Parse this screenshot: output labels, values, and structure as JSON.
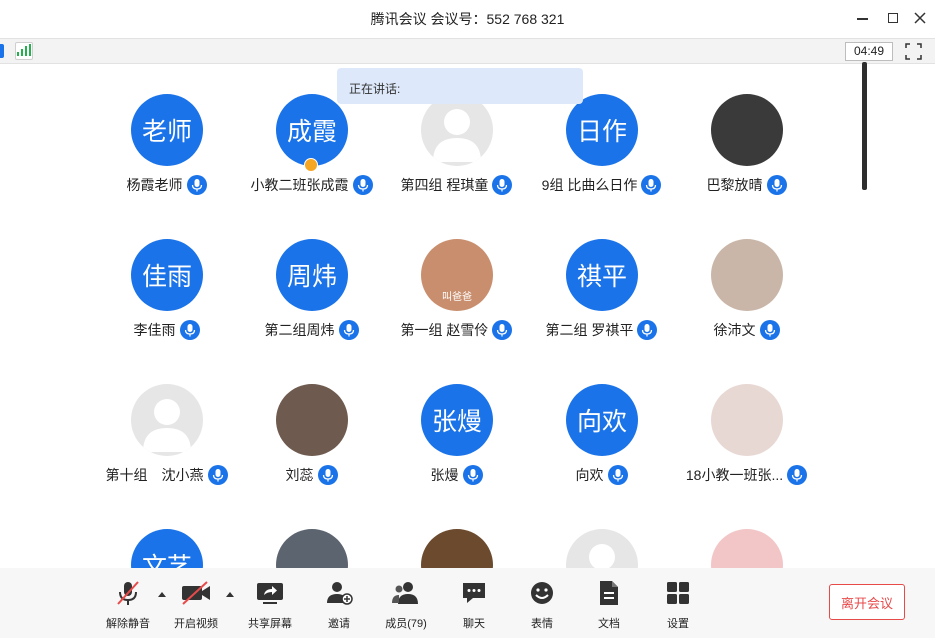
{
  "window": {
    "title": "腾讯会议 会议号：552 768 321"
  },
  "status": {
    "timer": "04:49"
  },
  "speaking": {
    "label": "正在讲话:"
  },
  "participants": [
    {
      "name": "杨霞老师",
      "avatar_text": "老师",
      "avatar_kind": "text"
    },
    {
      "name": "小教二班张成霞",
      "avatar_text": "成霞",
      "avatar_kind": "text",
      "host": true
    },
    {
      "name": "第四组 程琪童",
      "avatar_text": "",
      "avatar_kind": "default"
    },
    {
      "name": "9组 比曲么日作",
      "avatar_text": "日作",
      "avatar_kind": "text"
    },
    {
      "name": "巴黎放晴",
      "avatar_text": "",
      "avatar_kind": "photo",
      "photo_color": "#3a3a3a"
    },
    {
      "name": "李佳雨",
      "avatar_text": "佳雨",
      "avatar_kind": "text"
    },
    {
      "name": "第二组周炜",
      "avatar_text": "周炜",
      "avatar_kind": "text"
    },
    {
      "name": "第一组 赵雪伶",
      "avatar_text": "",
      "avatar_kind": "photo",
      "photo_color": "#c98e6d",
      "overlay": "叫爸爸"
    },
    {
      "name": "第二组 罗祺平",
      "avatar_text": "祺平",
      "avatar_kind": "text"
    },
    {
      "name": "徐沛文",
      "avatar_text": "",
      "avatar_kind": "photo",
      "photo_color": "#c9b6a8"
    },
    {
      "name": "第十组　沈小燕",
      "avatar_text": "",
      "avatar_kind": "default"
    },
    {
      "name": "刘蕊",
      "avatar_text": "",
      "avatar_kind": "photo",
      "photo_color": "#6e5a4e"
    },
    {
      "name": "张熳",
      "avatar_text": "张熳",
      "avatar_kind": "text"
    },
    {
      "name": "向欢",
      "avatar_text": "向欢",
      "avatar_kind": "text"
    },
    {
      "name": "18小教一班张...",
      "avatar_text": "",
      "avatar_kind": "photo",
      "photo_color": "#e8d8d4"
    },
    {
      "name": "",
      "avatar_text": "文艺",
      "avatar_kind": "text"
    },
    {
      "name": "",
      "avatar_text": "",
      "avatar_kind": "photo",
      "photo_color": "#5c6470"
    },
    {
      "name": "",
      "avatar_text": "",
      "avatar_kind": "photo",
      "photo_color": "#6b4a2e"
    },
    {
      "name": "",
      "avatar_text": "",
      "avatar_kind": "default"
    },
    {
      "name": "",
      "avatar_text": "",
      "avatar_kind": "photo",
      "photo_color": "#f2c6c6"
    }
  ],
  "toolbar": {
    "unmute": "解除静音",
    "start_video": "开启视频",
    "share_screen": "共享屏幕",
    "invite": "邀请",
    "members": "成员(79)",
    "chat": "聊天",
    "emoji": "表情",
    "docs": "文档",
    "settings": "设置",
    "leave": "离开会议"
  },
  "colors": {
    "accent": "#1a73e8",
    "leave": "#e84a4a",
    "signal": "#22b14c"
  }
}
